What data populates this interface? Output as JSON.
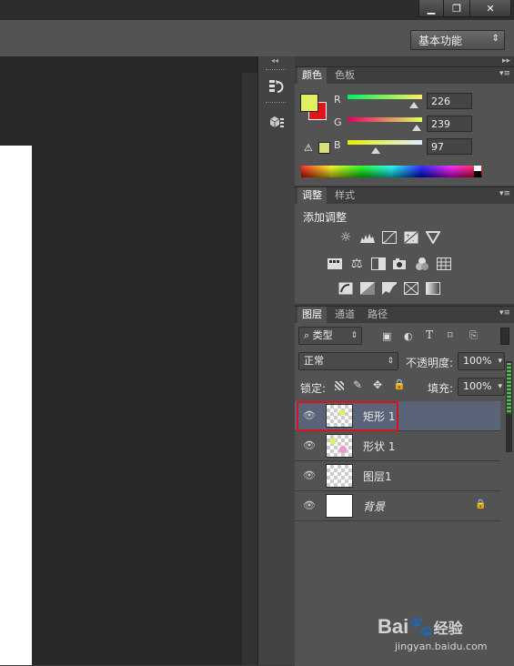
{
  "window": {
    "minimize_icon": "minimize-icon",
    "restore_icon": "restore-icon",
    "close_icon": "close-icon",
    "minimize_glyph": "▁",
    "restore_glyph": "❐",
    "close_glyph": "✕"
  },
  "options_bar": {
    "workspace_label": "基本功能",
    "workspace_arrow": "⇕"
  },
  "color_panel": {
    "tabs": [
      "颜色",
      "色板"
    ],
    "foreground_color": "#e2ef61",
    "background_color": "#e0141b",
    "channels": [
      {
        "label": "R",
        "value": "226"
      },
      {
        "label": "G",
        "value": "239"
      },
      {
        "label": "B",
        "value": "97"
      }
    ],
    "warning_icon": "gamut-warning-icon"
  },
  "adjustments_panel": {
    "tabs": [
      "调整",
      "样式"
    ],
    "heading": "添加调整",
    "icons_row1": [
      "brightness-icon",
      "levels-icon",
      "curves-icon",
      "exposure-icon",
      "vibrance-icon"
    ],
    "icons_row2": [
      "hue-saturation-icon",
      "color-balance-icon",
      "black-white-icon",
      "photo-filter-icon",
      "channel-mixer-icon",
      "color-lookup-icon"
    ],
    "icons_row3": [
      "invert-icon",
      "posterize-icon",
      "threshold-icon",
      "selective-color-icon",
      "gradient-map-icon"
    ]
  },
  "layers_panel": {
    "tabs": [
      "图层",
      "通道",
      "路径"
    ],
    "filter_kind": "类型",
    "blend_mode": "正常",
    "opacity_label": "不透明度:",
    "opacity_value": "100%",
    "lock_label": "锁定:",
    "fill_label": "填充:",
    "fill_value": "100%",
    "layers": [
      {
        "name": "矩形 1",
        "selected": true,
        "highlighted": true
      },
      {
        "name": "形状 1",
        "selected": false
      },
      {
        "name": "图层1",
        "selected": false
      },
      {
        "name": "背景",
        "selected": false,
        "locked": true
      }
    ],
    "highlight_color": "#d9121b"
  },
  "watermark": {
    "brand": "Bai",
    "brand2": "经验",
    "url": "jingyan.baidu.com"
  }
}
